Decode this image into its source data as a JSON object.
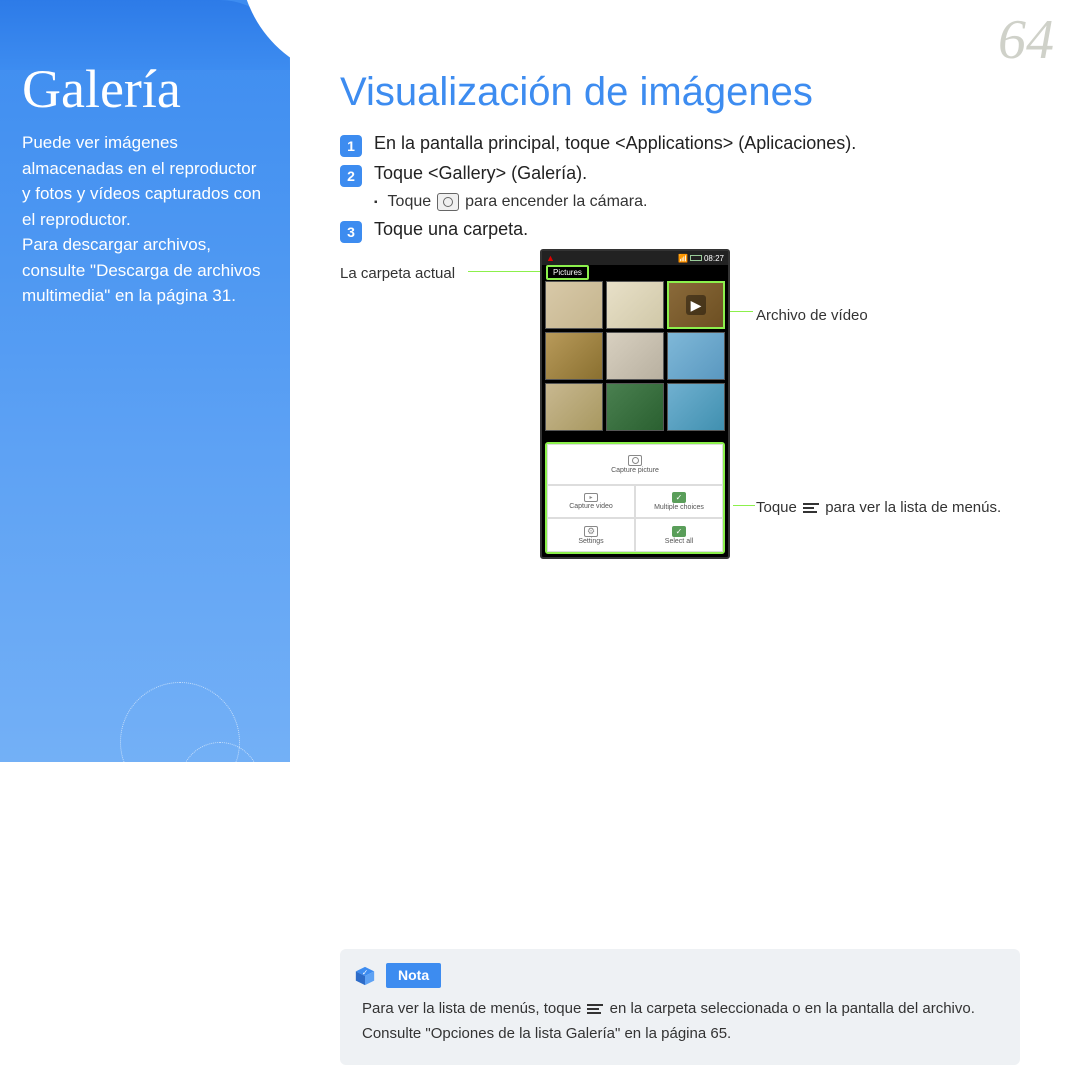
{
  "page_number": "64",
  "sidebar": {
    "title": "Galería",
    "desc": "Puede ver imágenes almacenadas en el reproductor y fotos y vídeos capturados con el reproductor.\nPara descargar archivos, consulte \"Descarga de archivos multimedia\" en la página 31."
  },
  "main": {
    "heading": "Visualización de imágenes",
    "steps": [
      {
        "num": "1",
        "text": "En la pantalla principal, toque <Applications> (Aplicaciones)."
      },
      {
        "num": "2",
        "text": "Toque <Gallery> (Galería)."
      },
      {
        "num": "3",
        "text": "Toque una carpeta."
      }
    ],
    "sub_bullet_pre": "Toque",
    "sub_bullet_post": "para encender la cámara.",
    "figure": {
      "label_current_folder": "La carpeta actual",
      "label_video_file": "Archivo de vídeo",
      "label_menu_pre": "Toque",
      "label_menu_post": "para ver la lista de menús."
    }
  },
  "phone": {
    "folder_name": "Pictures",
    "time": "08:27",
    "menu_items": {
      "capture_picture": "Capture picture",
      "capture_video": "Capture video",
      "multiple_choices": "Multiple choices",
      "settings": "Settings",
      "select_all": "Select all"
    }
  },
  "note": {
    "label": "Nota",
    "line1_pre": "Para ver la lista de menús, toque",
    "line1_post": "en la carpeta seleccionada o en la pantalla del archivo.",
    "line2": "Consulte \"Opciones de la lista Galería\" en la página 65."
  }
}
